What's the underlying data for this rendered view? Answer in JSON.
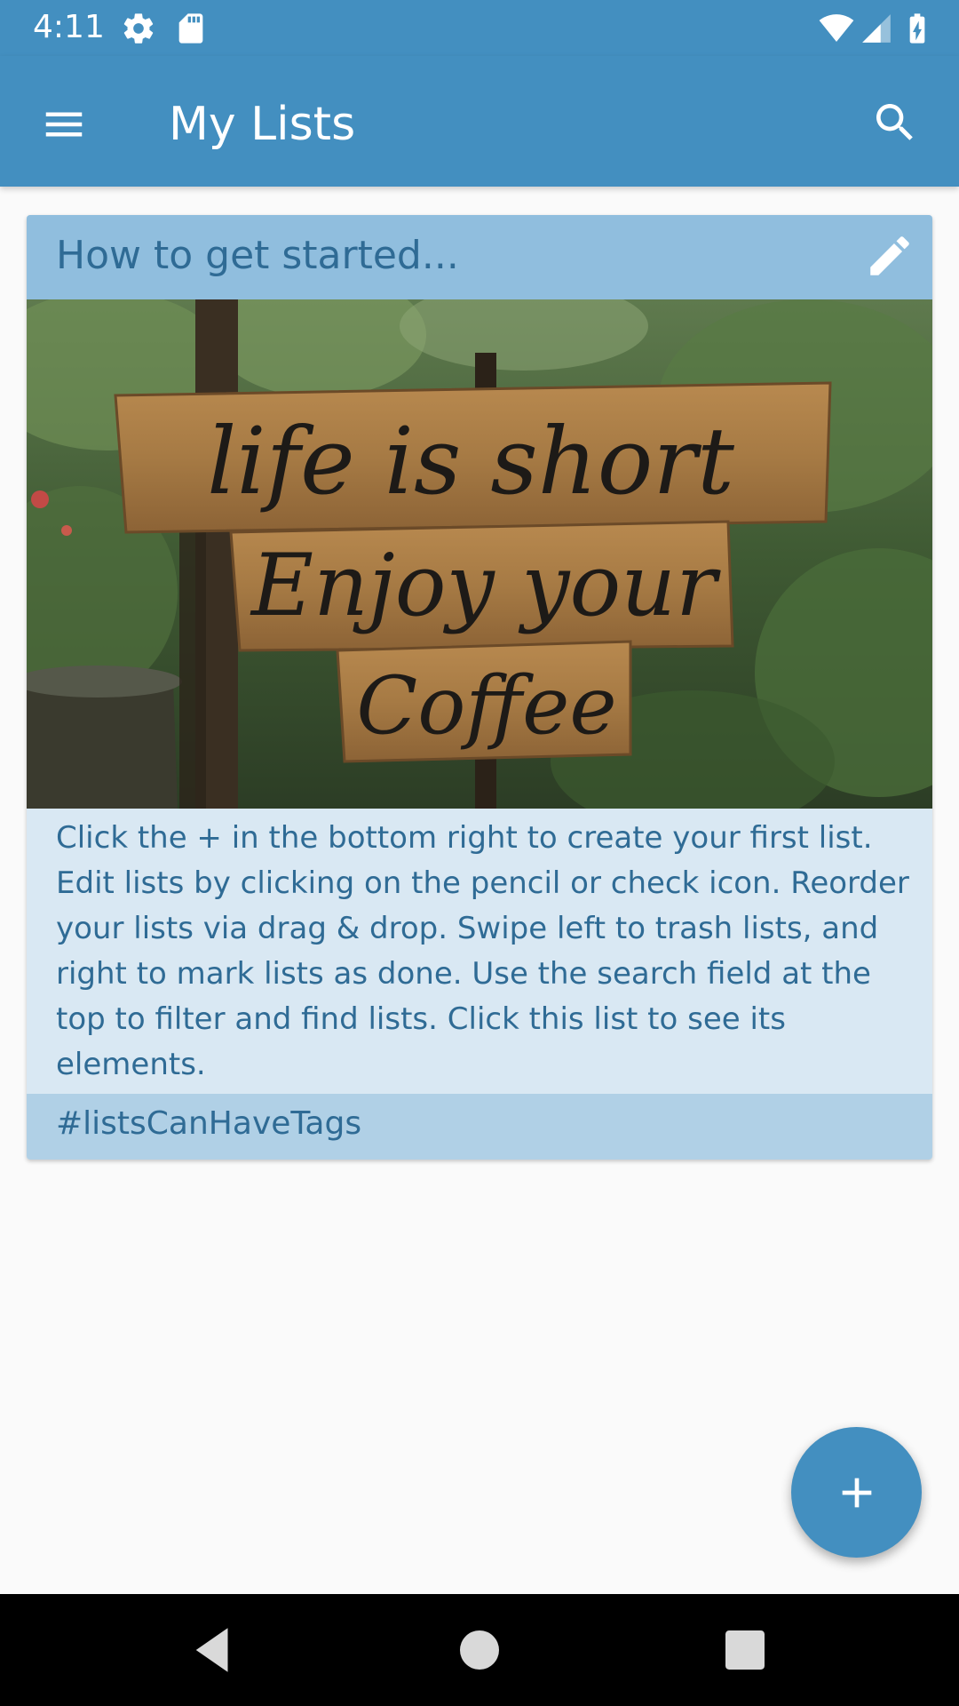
{
  "status_bar": {
    "time": "4:11",
    "icons": [
      "settings-icon",
      "sd-card-icon",
      "wifi-icon",
      "cell-signal-icon",
      "battery-charging-icon"
    ]
  },
  "app_bar": {
    "title": "My Lists",
    "menu_icon": "hamburger-menu-icon",
    "search_icon": "search-icon"
  },
  "card": {
    "title": "How to get started...",
    "edit_icon": "pencil-icon",
    "image_description_text": {
      "line1": "life is short",
      "line2": "Enjoy your",
      "line3": "Coffee"
    },
    "body": "Click the + in the bottom right to create your first list. Edit lists by clicking on the pencil or check icon. Reorder your lists via drag & drop. Swipe left to trash lists, and right to mark lists as done. Use the search field at the top to filter and find lists. Click this list to see its elements.",
    "tags": "#listsCanHaveTags"
  },
  "fab": {
    "icon": "plus-icon"
  },
  "nav_bar": {
    "icons": [
      "back-icon",
      "home-icon",
      "recents-icon"
    ]
  },
  "colors": {
    "primary": "#438fc0",
    "card_header": "#90bede",
    "card_body": "#d9e8f3",
    "card_tags": "#b0d0e6",
    "card_text": "#2f6b95"
  }
}
